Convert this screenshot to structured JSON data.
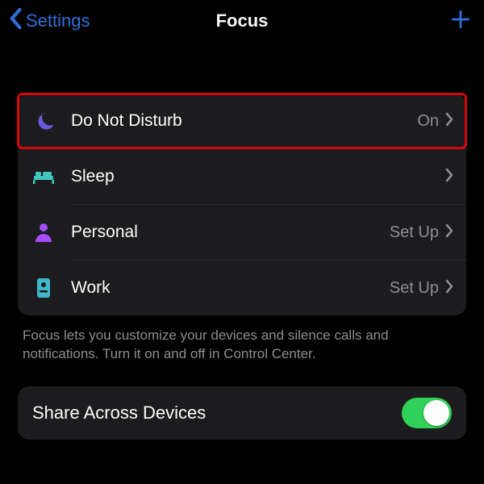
{
  "nav": {
    "back_label": "Settings",
    "title": "Focus"
  },
  "focus_modes": [
    {
      "icon": "moon",
      "icon_color": "#6a5ae0",
      "label": "Do Not Disturb",
      "status": "On",
      "highlighted": true
    },
    {
      "icon": "bed",
      "icon_color": "#3fc9c1",
      "label": "Sleep",
      "status": "",
      "highlighted": false
    },
    {
      "icon": "person",
      "icon_color": "#a64dff",
      "label": "Personal",
      "status": "Set Up",
      "highlighted": false
    },
    {
      "icon": "badge",
      "icon_color": "#3fb8c9",
      "label": "Work",
      "status": "Set Up",
      "highlighted": false
    }
  ],
  "footer": "Focus lets you customize your devices and silence calls and notifications. Turn it on and off in Control Center.",
  "share": {
    "label": "Share Across Devices",
    "on": true
  }
}
